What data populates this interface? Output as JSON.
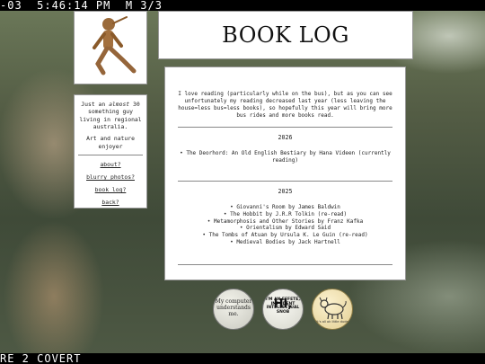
{
  "hud": {
    "top": "-03  5:46:14 PM  M 3/3",
    "bottom": "RE 2 COVERT"
  },
  "sidebar": {
    "bio_pre": "Just an ",
    "bio_em": "almost",
    "bio_post": " 30 something guy living in regional australia.",
    "tagline": "Art and nature enjoyer",
    "links": [
      "about?",
      "blurry photos?",
      "book log?",
      "back?"
    ]
  },
  "header": {
    "title": "BOOK LOG"
  },
  "main": {
    "intro": "I love reading (particularly while on the bus), but as you can see unfortunately my reading decreased last year (less leaving the house=less bus=less books), so hopefully this year will bring more bus rides and more books read.",
    "years": [
      {
        "year": "2026",
        "books": [
          "The Deorhord: An Old English Bestiary by Hana Videen (currently reading)"
        ]
      },
      {
        "year": "2025",
        "books": [
          "Giovanni's Room by James Baldwin",
          "The Hobbit by J.R.R Tolkin (re-read)",
          "Metamorphosis and Other Stories by Franz Kafka",
          "Orientalism by Edward Said",
          "The Tombs of Atuan by Ursula K. Le Guin (re-read)",
          "Medieval Bodies by Jack Hartnell"
        ]
      }
    ]
  },
  "buttons": {
    "computer": "My computer understands me.",
    "snob_big": "HI,",
    "snob_small": "I'M AN EFFETE, IMPUDENT INTELLECTUAL SNOB",
    "dog_caption": "it's all ok little dude"
  }
}
